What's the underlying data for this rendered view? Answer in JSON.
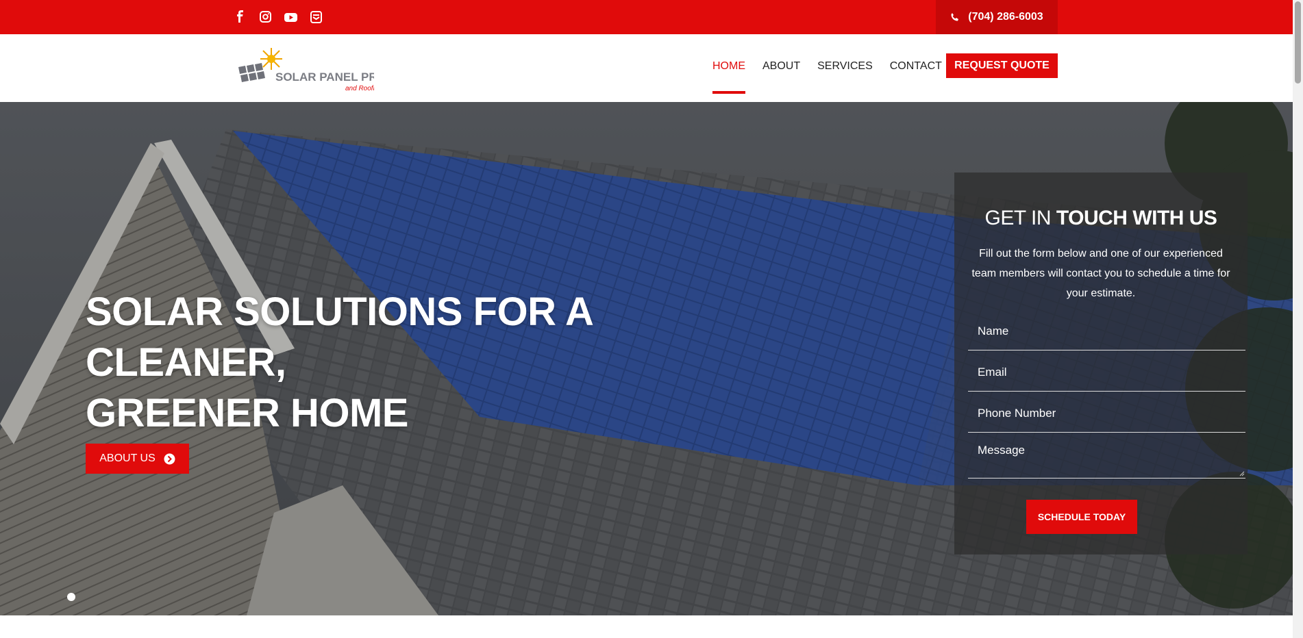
{
  "topbar": {
    "social_icons": [
      "facebook-icon",
      "instagram-icon",
      "youtube-icon",
      "email-icon"
    ],
    "phone": "(704) 286-6003"
  },
  "header": {
    "logo": {
      "name": "SOLAR PANEL PROS",
      "tagline": "and Roofing"
    },
    "nav": [
      "HOME",
      "ABOUT",
      "SERVICES",
      "CONTACT"
    ],
    "active_nav": "HOME",
    "cta": "REQUEST QUOTE"
  },
  "hero": {
    "title_line1": "SOLAR SOLUTIONS FOR A CLEANER,",
    "title_line2": "GREENER HOME",
    "button": "ABOUT US",
    "slides_count": 1
  },
  "form": {
    "heading_normal": "GET IN ",
    "heading_bold": "TOUCH WITH US",
    "intro": "Fill out the form below and one of our experienced team members will contact you to schedule a time for your estimate.",
    "placeholders": {
      "name": "Name",
      "email": "Email",
      "phone": "Phone Number",
      "message": "Message"
    },
    "submit": "SCHEDULE TODAY"
  },
  "colors": {
    "accent": "#e00b0b",
    "accent_dark": "#c50808",
    "panel_overlay": "rgba(45,45,45,0.72)"
  }
}
